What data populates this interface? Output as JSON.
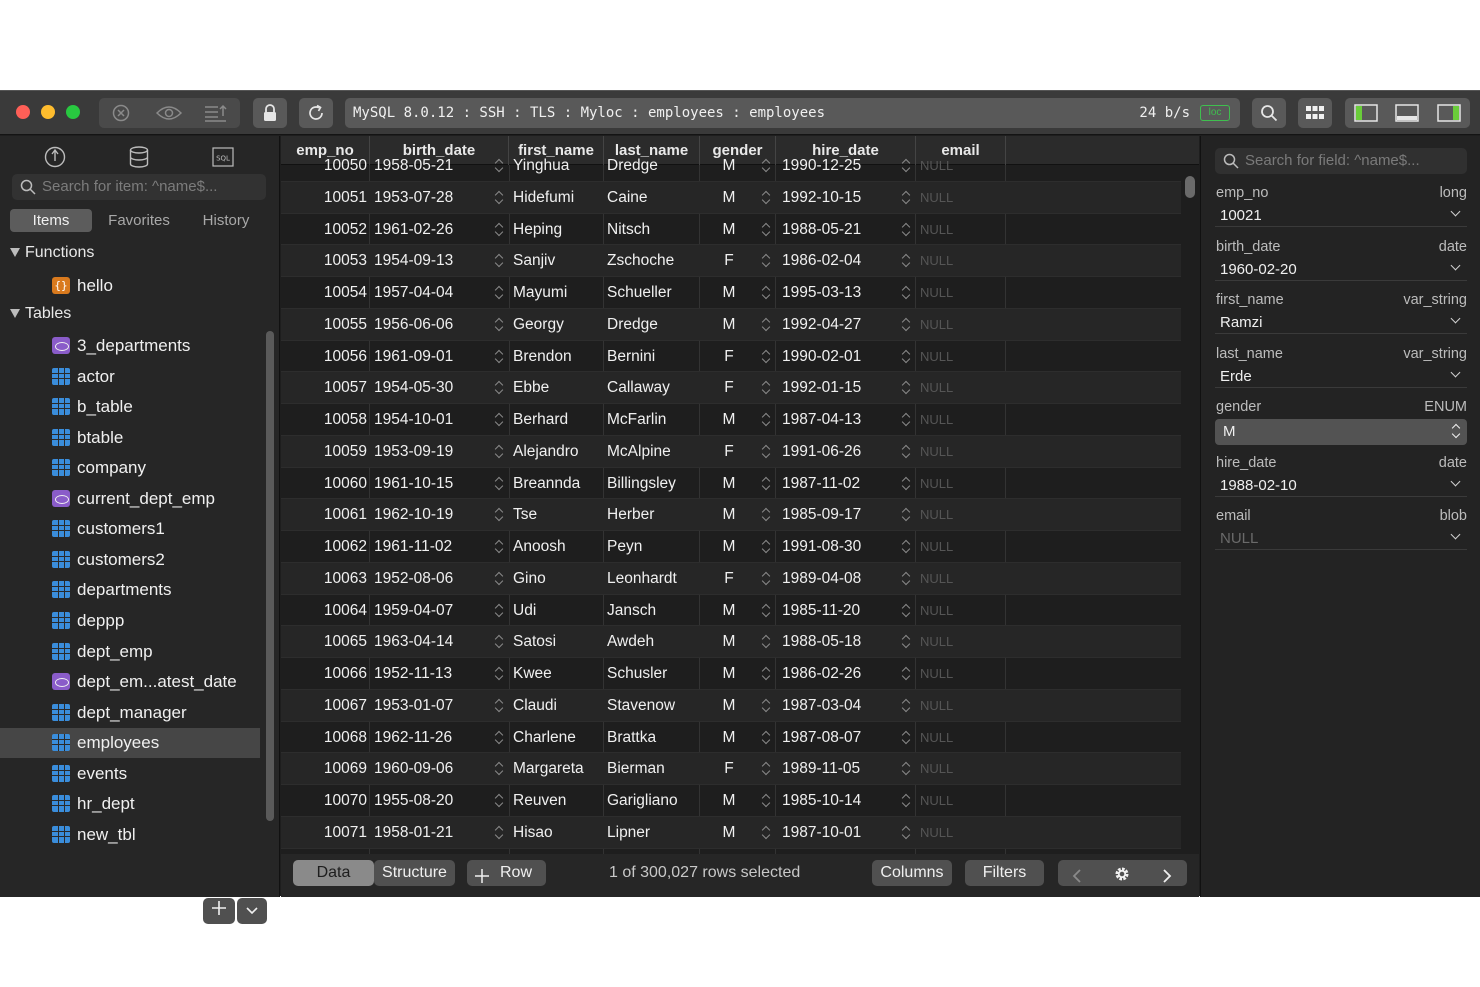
{
  "toolbar": {
    "address": "MySQL 8.0.12 : SSH : TLS : Myloc : employees : employees",
    "speed": "24 b/s",
    "loc_badge": "loc"
  },
  "sidebar": {
    "search_placeholder": "Search for item: ^name$...",
    "tabs": [
      "Items",
      "Favorites",
      "History"
    ],
    "functions_label": "Functions",
    "tables_label": "Tables",
    "functions": [
      {
        "label": "hello",
        "icon": "function-icon"
      }
    ],
    "tables": [
      {
        "label": "3_departments",
        "icon": "view-icon"
      },
      {
        "label": "actor",
        "icon": "table-icon"
      },
      {
        "label": "b_table",
        "icon": "table-icon"
      },
      {
        "label": "btable",
        "icon": "table-icon"
      },
      {
        "label": "company",
        "icon": "table-icon"
      },
      {
        "label": "current_dept_emp",
        "icon": "view-icon"
      },
      {
        "label": "customers1",
        "icon": "table-icon"
      },
      {
        "label": "customers2",
        "icon": "table-icon"
      },
      {
        "label": "departments",
        "icon": "table-icon"
      },
      {
        "label": "deppp",
        "icon": "table-icon"
      },
      {
        "label": "dept_emp",
        "icon": "table-icon"
      },
      {
        "label": "dept_em...atest_date",
        "icon": "view-icon"
      },
      {
        "label": "dept_manager",
        "icon": "table-icon"
      },
      {
        "label": "employees",
        "icon": "table-icon",
        "selected": true
      },
      {
        "label": "events",
        "icon": "table-icon"
      },
      {
        "label": "hr_dept",
        "icon": "table-icon"
      },
      {
        "label": "new_tbl",
        "icon": "table-icon"
      }
    ]
  },
  "grid": {
    "columns": [
      "emp_no",
      "birth_date",
      "first_name",
      "last_name",
      "gender",
      "hire_date",
      "email"
    ],
    "rows": [
      [
        "10050",
        "1958-05-21",
        "Yinghua",
        "Dredge",
        "M",
        "1990-12-25",
        "NULL"
      ],
      [
        "10051",
        "1953-07-28",
        "Hidefumi",
        "Caine",
        "M",
        "1992-10-15",
        "NULL"
      ],
      [
        "10052",
        "1961-02-26",
        "Heping",
        "Nitsch",
        "M",
        "1988-05-21",
        "NULL"
      ],
      [
        "10053",
        "1954-09-13",
        "Sanjiv",
        "Zschoche",
        "F",
        "1986-02-04",
        "NULL"
      ],
      [
        "10054",
        "1957-04-04",
        "Mayumi",
        "Schueller",
        "M",
        "1995-03-13",
        "NULL"
      ],
      [
        "10055",
        "1956-06-06",
        "Georgy",
        "Dredge",
        "M",
        "1992-04-27",
        "NULL"
      ],
      [
        "10056",
        "1961-09-01",
        "Brendon",
        "Bernini",
        "F",
        "1990-02-01",
        "NULL"
      ],
      [
        "10057",
        "1954-05-30",
        "Ebbe",
        "Callaway",
        "F",
        "1992-01-15",
        "NULL"
      ],
      [
        "10058",
        "1954-10-01",
        "Berhard",
        "McFarlin",
        "M",
        "1987-04-13",
        "NULL"
      ],
      [
        "10059",
        "1953-09-19",
        "Alejandro",
        "McAlpine",
        "F",
        "1991-06-26",
        "NULL"
      ],
      [
        "10060",
        "1961-10-15",
        "Breannda",
        "Billingsley",
        "M",
        "1987-11-02",
        "NULL"
      ],
      [
        "10061",
        "1962-10-19",
        "Tse",
        "Herber",
        "M",
        "1985-09-17",
        "NULL"
      ],
      [
        "10062",
        "1961-11-02",
        "Anoosh",
        "Peyn",
        "M",
        "1991-08-30",
        "NULL"
      ],
      [
        "10063",
        "1952-08-06",
        "Gino",
        "Leonhardt",
        "F",
        "1989-04-08",
        "NULL"
      ],
      [
        "10064",
        "1959-04-07",
        "Udi",
        "Jansch",
        "M",
        "1985-11-20",
        "NULL"
      ],
      [
        "10065",
        "1963-04-14",
        "Satosi",
        "Awdeh",
        "M",
        "1988-05-18",
        "NULL"
      ],
      [
        "10066",
        "1952-11-13",
        "Kwee",
        "Schusler",
        "M",
        "1986-02-26",
        "NULL"
      ],
      [
        "10067",
        "1953-01-07",
        "Claudi",
        "Stavenow",
        "M",
        "1987-03-04",
        "NULL"
      ],
      [
        "10068",
        "1962-11-26",
        "Charlene",
        "Brattka",
        "M",
        "1987-08-07",
        "NULL"
      ],
      [
        "10069",
        "1960-09-06",
        "Margareta",
        "Bierman",
        "F",
        "1989-11-05",
        "NULL"
      ],
      [
        "10070",
        "1955-08-20",
        "Reuven",
        "Garigliano",
        "M",
        "1985-10-14",
        "NULL"
      ],
      [
        "10071",
        "1958-01-21",
        "Hisao",
        "Lipner",
        "M",
        "1987-10-01",
        "NULL"
      ]
    ]
  },
  "bottombar": {
    "data_label": "Data",
    "structure_label": "Structure",
    "row_label": "Row",
    "status": "1 of 300,027 rows selected",
    "columns_label": "Columns",
    "filters_label": "Filters"
  },
  "panel": {
    "search_placeholder": "Search for field: ^name$...",
    "fields": [
      {
        "name": "emp_no",
        "type": "long",
        "value": "10021"
      },
      {
        "name": "birth_date",
        "type": "date",
        "value": "1960-02-20"
      },
      {
        "name": "first_name",
        "type": "var_string",
        "value": "Ramzi"
      },
      {
        "name": "last_name",
        "type": "var_string",
        "value": "Erde"
      },
      {
        "name": "gender",
        "type": "ENUM",
        "value": "M"
      },
      {
        "name": "hire_date",
        "type": "date",
        "value": "1988-02-10"
      },
      {
        "name": "email",
        "type": "blob",
        "value": "NULL"
      }
    ]
  },
  "colors": {
    "accent_green": "#3fbf4f",
    "table_icon": "#3a8ddb",
    "view_icon": "#8a5cc9",
    "function_icon": "#d97a1e"
  }
}
